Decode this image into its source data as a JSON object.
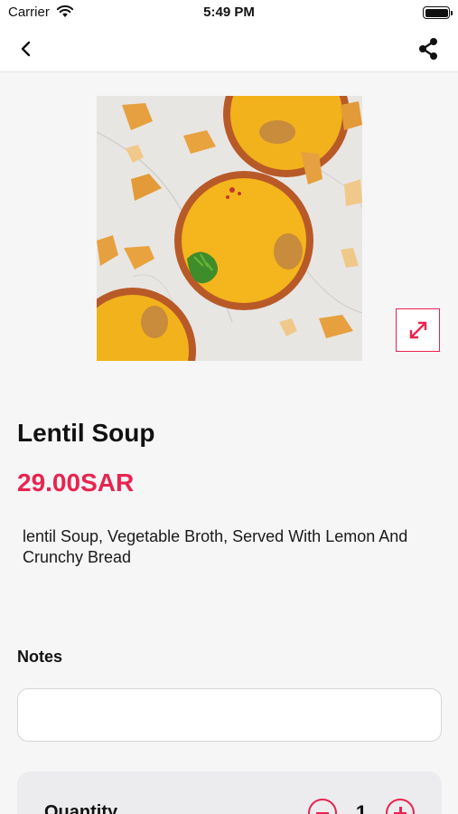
{
  "status_bar": {
    "carrier": "Carrier",
    "time": "5:49 PM"
  },
  "nav": {
    "back_icon": "chevron-left-icon",
    "share_icon": "share-icon"
  },
  "product": {
    "image_icon": "lentil-soup-photo",
    "expand_icon": "expand-arrows-icon",
    "name": "Lentil Soup",
    "price": "29.00SAR",
    "description": "lentil Soup, Vegetable Broth, Served With Lemon And Crunchy Bread"
  },
  "notes": {
    "label": "Notes",
    "value": "",
    "placeholder": ""
  },
  "quantity": {
    "label": "Quantity",
    "value": "1",
    "minus_icon": "minus-circle-icon",
    "plus_icon": "plus-circle-icon"
  },
  "colors": {
    "accent": "#e8244f",
    "background": "#f6f6f7",
    "soup": "#f4b41a",
    "bowl": "#c9662f"
  }
}
